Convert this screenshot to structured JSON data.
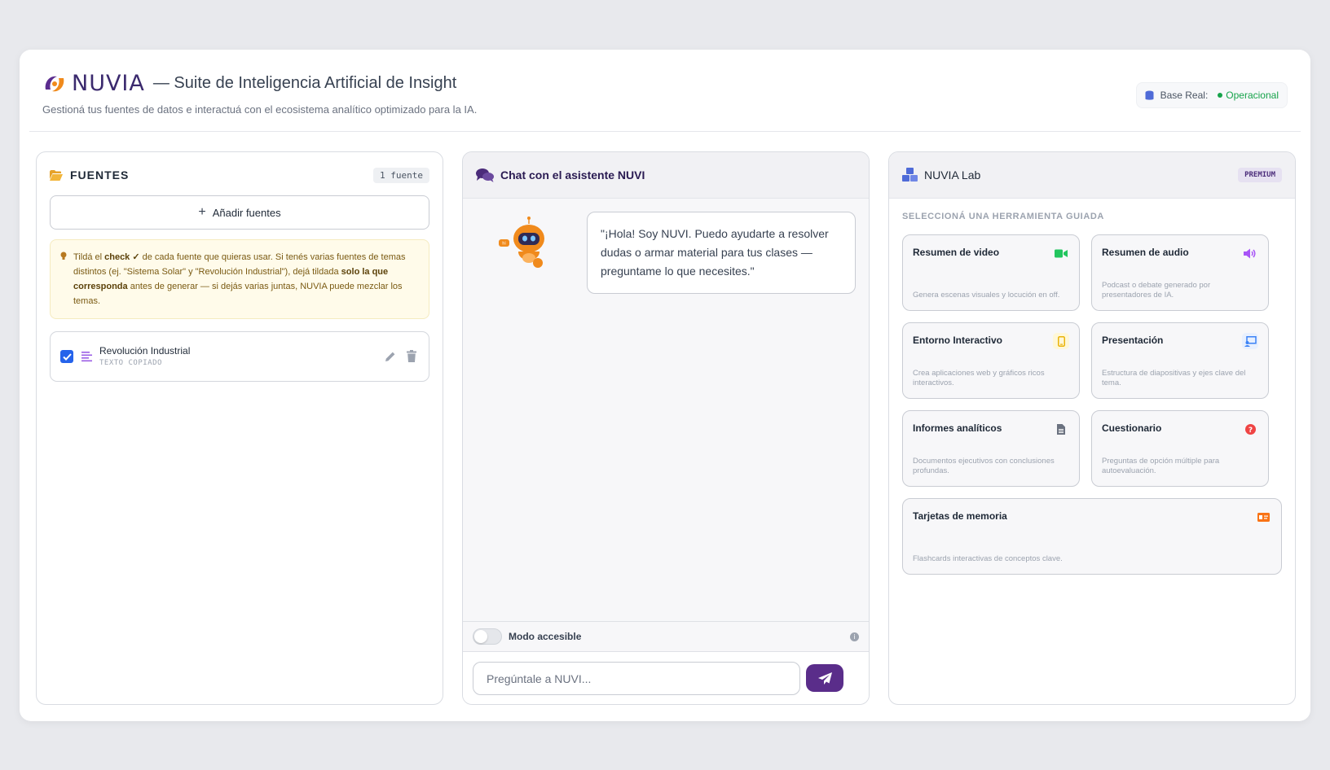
{
  "header": {
    "logo": "NUVIA",
    "title": "— Suite de Inteligencia Artificial de Insight",
    "subtitle": "Gestioná tus fuentes de datos e interactuá con el ecosistema analítico optimizado para la IA.",
    "status_label": "Base Real:",
    "status_value": "Operacional"
  },
  "sources": {
    "title": "FUENTES",
    "count": "1 fuente",
    "add_label": "Añadir fuentes",
    "tip": {
      "t1": "Tildá el ",
      "b1": "check ✓",
      "t2": " de cada fuente que quieras usar. Si tenés varias fuentes de temas distintos (ej. \"Sistema Solar\" y \"Revolución Industrial\"), dejá tildada ",
      "b2": "solo la que corresponda",
      "t3": " antes de generar — si dejás varias juntas, NUVIA puede mezclar los temas."
    },
    "items": [
      {
        "name": "Revolución Industrial",
        "type": "TEXTO COPIADO"
      }
    ]
  },
  "chat": {
    "title": "Chat con el asistente NUVI",
    "greeting": "\"¡Hola! Soy NUVI. Puedo ayudarte a resolver dudas o armar material para tus clases — preguntame lo que necesites.\"",
    "accessible_label": "Modo accesible",
    "input_placeholder": "Pregúntale a NUVI..."
  },
  "lab": {
    "title": "NUVIA Lab",
    "badge": "PREMIUM",
    "section": "SELECCIONÁ UNA HERRAMIENTA GUIADA",
    "tools": [
      {
        "name": "Resumen de video",
        "desc": "Genera escenas visuales y locución en off.",
        "icon": "video-camera-icon",
        "color": "#22c55e"
      },
      {
        "name": "Resumen de audio",
        "desc": "Podcast o debate generado por presentadores de IA.",
        "icon": "speaker-icon",
        "color": "#a855f7"
      },
      {
        "name": "Entorno Interactivo",
        "desc": "Crea aplicaciones web y gráficos ricos interactivos.",
        "icon": "mobile-icon",
        "color": "#eab308"
      },
      {
        "name": "Presentación",
        "desc": "Estructura de diapositivas y ejes clave del tema.",
        "icon": "presentation-icon",
        "color": "#3b82f6"
      },
      {
        "name": "Informes analíticos",
        "desc": "Documentos ejecutivos con conclusiones profundas.",
        "icon": "document-icon",
        "color": "#6b7280"
      },
      {
        "name": "Cuestionario",
        "desc": "Preguntas de opción múltiple para autoevaluación.",
        "icon": "question-icon",
        "color": "#ef4444"
      },
      {
        "name": "Tarjetas de memoria",
        "desc": "Flashcards interactivas de conceptos clave.",
        "icon": "id-card-icon",
        "color": "#f97316"
      }
    ]
  }
}
